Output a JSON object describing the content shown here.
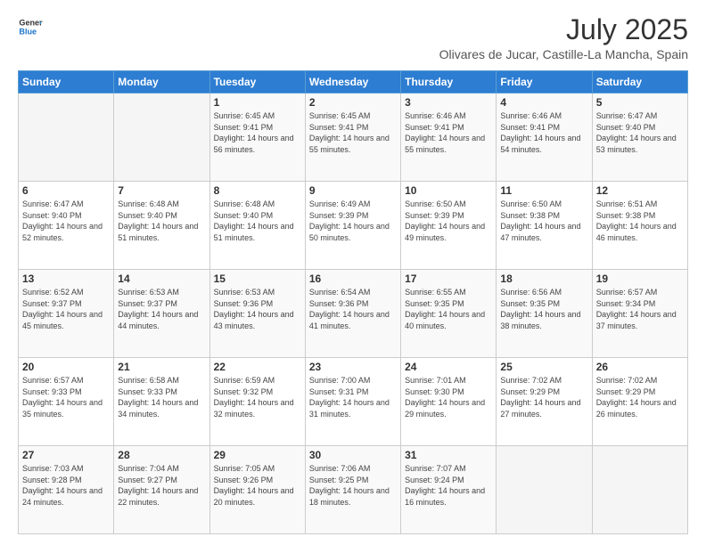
{
  "logo": {
    "line1": "General",
    "line2": "Blue"
  },
  "title": "July 2025",
  "subtitle": "Olivares de Jucar, Castille-La Mancha, Spain",
  "weekdays": [
    "Sunday",
    "Monday",
    "Tuesday",
    "Wednesday",
    "Thursday",
    "Friday",
    "Saturday"
  ],
  "weeks": [
    [
      {
        "day": "",
        "sunrise": "",
        "sunset": "",
        "daylight": ""
      },
      {
        "day": "",
        "sunrise": "",
        "sunset": "",
        "daylight": ""
      },
      {
        "day": "1",
        "sunrise": "Sunrise: 6:45 AM",
        "sunset": "Sunset: 9:41 PM",
        "daylight": "Daylight: 14 hours and 56 minutes."
      },
      {
        "day": "2",
        "sunrise": "Sunrise: 6:45 AM",
        "sunset": "Sunset: 9:41 PM",
        "daylight": "Daylight: 14 hours and 55 minutes."
      },
      {
        "day": "3",
        "sunrise": "Sunrise: 6:46 AM",
        "sunset": "Sunset: 9:41 PM",
        "daylight": "Daylight: 14 hours and 55 minutes."
      },
      {
        "day": "4",
        "sunrise": "Sunrise: 6:46 AM",
        "sunset": "Sunset: 9:41 PM",
        "daylight": "Daylight: 14 hours and 54 minutes."
      },
      {
        "day": "5",
        "sunrise": "Sunrise: 6:47 AM",
        "sunset": "Sunset: 9:40 PM",
        "daylight": "Daylight: 14 hours and 53 minutes."
      }
    ],
    [
      {
        "day": "6",
        "sunrise": "Sunrise: 6:47 AM",
        "sunset": "Sunset: 9:40 PM",
        "daylight": "Daylight: 14 hours and 52 minutes."
      },
      {
        "day": "7",
        "sunrise": "Sunrise: 6:48 AM",
        "sunset": "Sunset: 9:40 PM",
        "daylight": "Daylight: 14 hours and 51 minutes."
      },
      {
        "day": "8",
        "sunrise": "Sunrise: 6:48 AM",
        "sunset": "Sunset: 9:40 PM",
        "daylight": "Daylight: 14 hours and 51 minutes."
      },
      {
        "day": "9",
        "sunrise": "Sunrise: 6:49 AM",
        "sunset": "Sunset: 9:39 PM",
        "daylight": "Daylight: 14 hours and 50 minutes."
      },
      {
        "day": "10",
        "sunrise": "Sunrise: 6:50 AM",
        "sunset": "Sunset: 9:39 PM",
        "daylight": "Daylight: 14 hours and 49 minutes."
      },
      {
        "day": "11",
        "sunrise": "Sunrise: 6:50 AM",
        "sunset": "Sunset: 9:38 PM",
        "daylight": "Daylight: 14 hours and 47 minutes."
      },
      {
        "day": "12",
        "sunrise": "Sunrise: 6:51 AM",
        "sunset": "Sunset: 9:38 PM",
        "daylight": "Daylight: 14 hours and 46 minutes."
      }
    ],
    [
      {
        "day": "13",
        "sunrise": "Sunrise: 6:52 AM",
        "sunset": "Sunset: 9:37 PM",
        "daylight": "Daylight: 14 hours and 45 minutes."
      },
      {
        "day": "14",
        "sunrise": "Sunrise: 6:53 AM",
        "sunset": "Sunset: 9:37 PM",
        "daylight": "Daylight: 14 hours and 44 minutes."
      },
      {
        "day": "15",
        "sunrise": "Sunrise: 6:53 AM",
        "sunset": "Sunset: 9:36 PM",
        "daylight": "Daylight: 14 hours and 43 minutes."
      },
      {
        "day": "16",
        "sunrise": "Sunrise: 6:54 AM",
        "sunset": "Sunset: 9:36 PM",
        "daylight": "Daylight: 14 hours and 41 minutes."
      },
      {
        "day": "17",
        "sunrise": "Sunrise: 6:55 AM",
        "sunset": "Sunset: 9:35 PM",
        "daylight": "Daylight: 14 hours and 40 minutes."
      },
      {
        "day": "18",
        "sunrise": "Sunrise: 6:56 AM",
        "sunset": "Sunset: 9:35 PM",
        "daylight": "Daylight: 14 hours and 38 minutes."
      },
      {
        "day": "19",
        "sunrise": "Sunrise: 6:57 AM",
        "sunset": "Sunset: 9:34 PM",
        "daylight": "Daylight: 14 hours and 37 minutes."
      }
    ],
    [
      {
        "day": "20",
        "sunrise": "Sunrise: 6:57 AM",
        "sunset": "Sunset: 9:33 PM",
        "daylight": "Daylight: 14 hours and 35 minutes."
      },
      {
        "day": "21",
        "sunrise": "Sunrise: 6:58 AM",
        "sunset": "Sunset: 9:33 PM",
        "daylight": "Daylight: 14 hours and 34 minutes."
      },
      {
        "day": "22",
        "sunrise": "Sunrise: 6:59 AM",
        "sunset": "Sunset: 9:32 PM",
        "daylight": "Daylight: 14 hours and 32 minutes."
      },
      {
        "day": "23",
        "sunrise": "Sunrise: 7:00 AM",
        "sunset": "Sunset: 9:31 PM",
        "daylight": "Daylight: 14 hours and 31 minutes."
      },
      {
        "day": "24",
        "sunrise": "Sunrise: 7:01 AM",
        "sunset": "Sunset: 9:30 PM",
        "daylight": "Daylight: 14 hours and 29 minutes."
      },
      {
        "day": "25",
        "sunrise": "Sunrise: 7:02 AM",
        "sunset": "Sunset: 9:29 PM",
        "daylight": "Daylight: 14 hours and 27 minutes."
      },
      {
        "day": "26",
        "sunrise": "Sunrise: 7:02 AM",
        "sunset": "Sunset: 9:29 PM",
        "daylight": "Daylight: 14 hours and 26 minutes."
      }
    ],
    [
      {
        "day": "27",
        "sunrise": "Sunrise: 7:03 AM",
        "sunset": "Sunset: 9:28 PM",
        "daylight": "Daylight: 14 hours and 24 minutes."
      },
      {
        "day": "28",
        "sunrise": "Sunrise: 7:04 AM",
        "sunset": "Sunset: 9:27 PM",
        "daylight": "Daylight: 14 hours and 22 minutes."
      },
      {
        "day": "29",
        "sunrise": "Sunrise: 7:05 AM",
        "sunset": "Sunset: 9:26 PM",
        "daylight": "Daylight: 14 hours and 20 minutes."
      },
      {
        "day": "30",
        "sunrise": "Sunrise: 7:06 AM",
        "sunset": "Sunset: 9:25 PM",
        "daylight": "Daylight: 14 hours and 18 minutes."
      },
      {
        "day": "31",
        "sunrise": "Sunrise: 7:07 AM",
        "sunset": "Sunset: 9:24 PM",
        "daylight": "Daylight: 14 hours and 16 minutes."
      },
      {
        "day": "",
        "sunrise": "",
        "sunset": "",
        "daylight": ""
      },
      {
        "day": "",
        "sunrise": "",
        "sunset": "",
        "daylight": ""
      }
    ]
  ]
}
